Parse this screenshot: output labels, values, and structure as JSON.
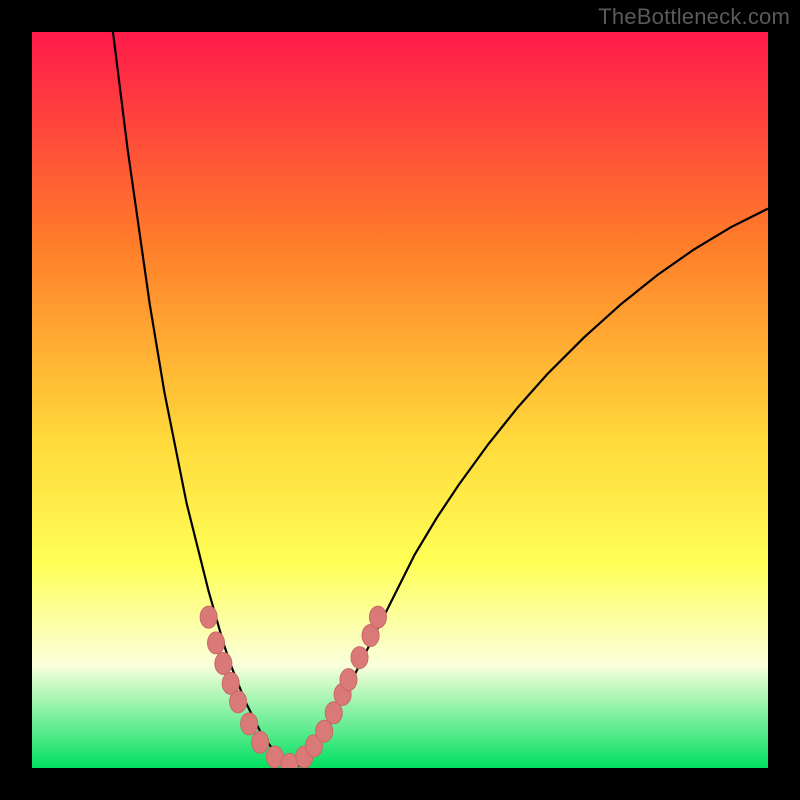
{
  "watermark": "TheBottleneck.com",
  "colors": {
    "frame_bg": "#000000",
    "gradient_top": "#ff1a4a",
    "gradient_mid1": "#ff7a2a",
    "gradient_mid2": "#ffd83a",
    "gradient_mid3": "#ffff55",
    "gradient_mid4": "#faffdc",
    "gradient_bottom": "#00e060",
    "curve": "#000000",
    "dot_fill": "#d97a78",
    "dot_stroke": "#c86866"
  },
  "chart_data": {
    "type": "line",
    "title": "",
    "xlabel": "",
    "ylabel": "",
    "xlim": [
      0,
      100
    ],
    "ylim": [
      0,
      100
    ],
    "curve": {
      "x": [
        11,
        12,
        13,
        14,
        15,
        16,
        17,
        18,
        19,
        20,
        21,
        22,
        23,
        24,
        25,
        26,
        27,
        28,
        29,
        30,
        31,
        32,
        33,
        34,
        35,
        36,
        37,
        38,
        39,
        40,
        42,
        44,
        46,
        48,
        50,
        52,
        55,
        58,
        62,
        66,
        70,
        75,
        80,
        85,
        90,
        95,
        100
      ],
      "y": [
        100,
        92,
        84,
        77,
        70,
        63,
        57,
        51,
        46,
        41,
        36,
        32,
        28,
        24,
        20.5,
        17,
        14,
        11.5,
        9,
        7,
        5,
        3.5,
        2.2,
        1.2,
        0.5,
        0.2,
        0.5,
        1.5,
        3,
        5,
        9,
        13,
        17,
        21,
        25,
        29,
        34,
        38.5,
        44,
        49,
        53.5,
        58.5,
        63,
        67,
        70.5,
        73.5,
        76
      ]
    },
    "dots": {
      "x": [
        24,
        25,
        26,
        27,
        28,
        29.5,
        31,
        33,
        35,
        37,
        38.3,
        39.7,
        41,
        42.2,
        43,
        44.5,
        46,
        47
      ],
      "y": [
        20.5,
        17,
        14.2,
        11.5,
        9,
        6,
        3.5,
        1.5,
        0.5,
        1.5,
        3,
        5,
        7.5,
        10,
        12,
        15,
        18,
        20.5
      ]
    },
    "gradient_stops": [
      {
        "offset": 0.0,
        "color": "#ff1a4a"
      },
      {
        "offset": 0.28,
        "color": "#ff7a2a"
      },
      {
        "offset": 0.55,
        "color": "#ffd83a"
      },
      {
        "offset": 0.72,
        "color": "#ffff55"
      },
      {
        "offset": 0.86,
        "color": "#faffdc"
      },
      {
        "offset": 1.0,
        "color": "#00e060"
      }
    ]
  }
}
